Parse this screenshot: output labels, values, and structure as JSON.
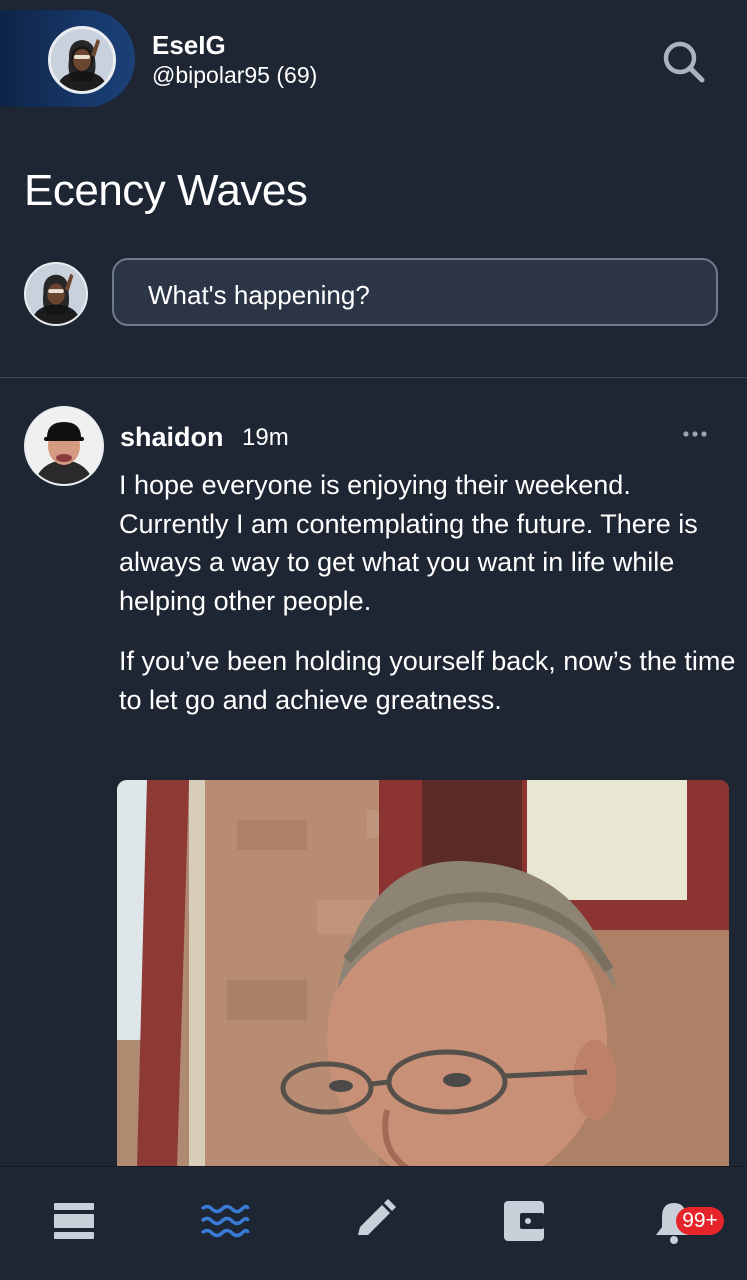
{
  "header": {
    "display_name": "EseIG",
    "handle": "@bipolar95 (69)",
    "search_icon": "search-icon"
  },
  "page": {
    "title": "Ecency Waves"
  },
  "composer": {
    "placeholder": "What's happening?"
  },
  "post": {
    "author": "shaidon",
    "time": "19m",
    "paragraphs": [
      "I hope everyone is enjoying their weekend. Currently I am contemplating the future. There is always a way to get what you want in life while helping other people.",
      "If you’ve been holding yourself back, now’s the time to let go and achieve greatness."
    ],
    "more_icon": "more-horizontal-icon"
  },
  "bottom_nav": {
    "items": [
      {
        "icon": "feed-icon"
      },
      {
        "icon": "waves-icon",
        "active": true
      },
      {
        "icon": "pencil-icon"
      },
      {
        "icon": "wallet-icon"
      },
      {
        "icon": "bell-icon"
      }
    ],
    "notification_badge": "99+"
  },
  "colors": {
    "background": "#1e2533",
    "input_background": "#2b3546",
    "accent_active": "#3a7bd5",
    "badge": "#e5252a",
    "pill_gradient_end": "#1c4177"
  }
}
